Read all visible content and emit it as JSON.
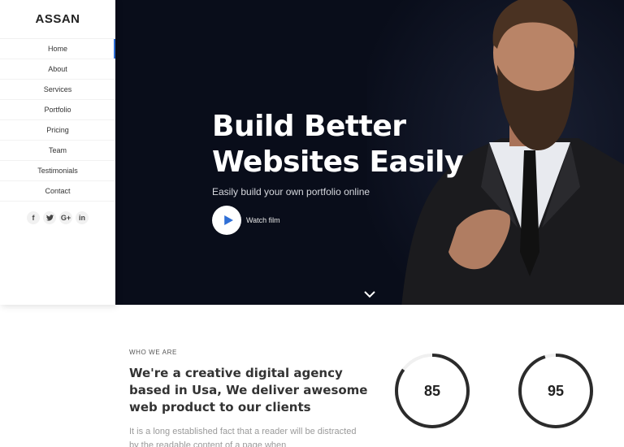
{
  "brand": {
    "logo": "ASSAN",
    "accent": "#2f6fd6"
  },
  "sidebar": {
    "nav": [
      {
        "label": "Home",
        "active": true
      },
      {
        "label": "About"
      },
      {
        "label": "Services"
      },
      {
        "label": "Portfolio"
      },
      {
        "label": "Pricing"
      },
      {
        "label": "Team"
      },
      {
        "label": "Testimonials"
      },
      {
        "label": "Contact"
      }
    ],
    "socials": [
      {
        "icon": "facebook-icon",
        "glyph": "f"
      },
      {
        "icon": "twitter-icon",
        "glyph": "t"
      },
      {
        "icon": "google-plus-icon",
        "glyph": "G+"
      },
      {
        "icon": "linkedin-icon",
        "glyph": "in"
      }
    ]
  },
  "hero": {
    "title_line1": "Build Better",
    "title_line2": "Websites Easily",
    "subtitle": "Easily build your own portfolio online",
    "watch_label": "Watch film",
    "play_icon": "play-icon",
    "scroll_icon": "chevron-down-icon",
    "background": "#090d1a"
  },
  "about": {
    "kicker": "WHO WE ARE",
    "title": "We're a creative digital agency based in Usa, We deliver awesome web product to our clients",
    "body": "It is a long established fact that a reader will be distracted by the readable content of a page when"
  },
  "stats": [
    {
      "value": "85",
      "percent": 85
    },
    {
      "value": "95",
      "percent": 95
    }
  ]
}
